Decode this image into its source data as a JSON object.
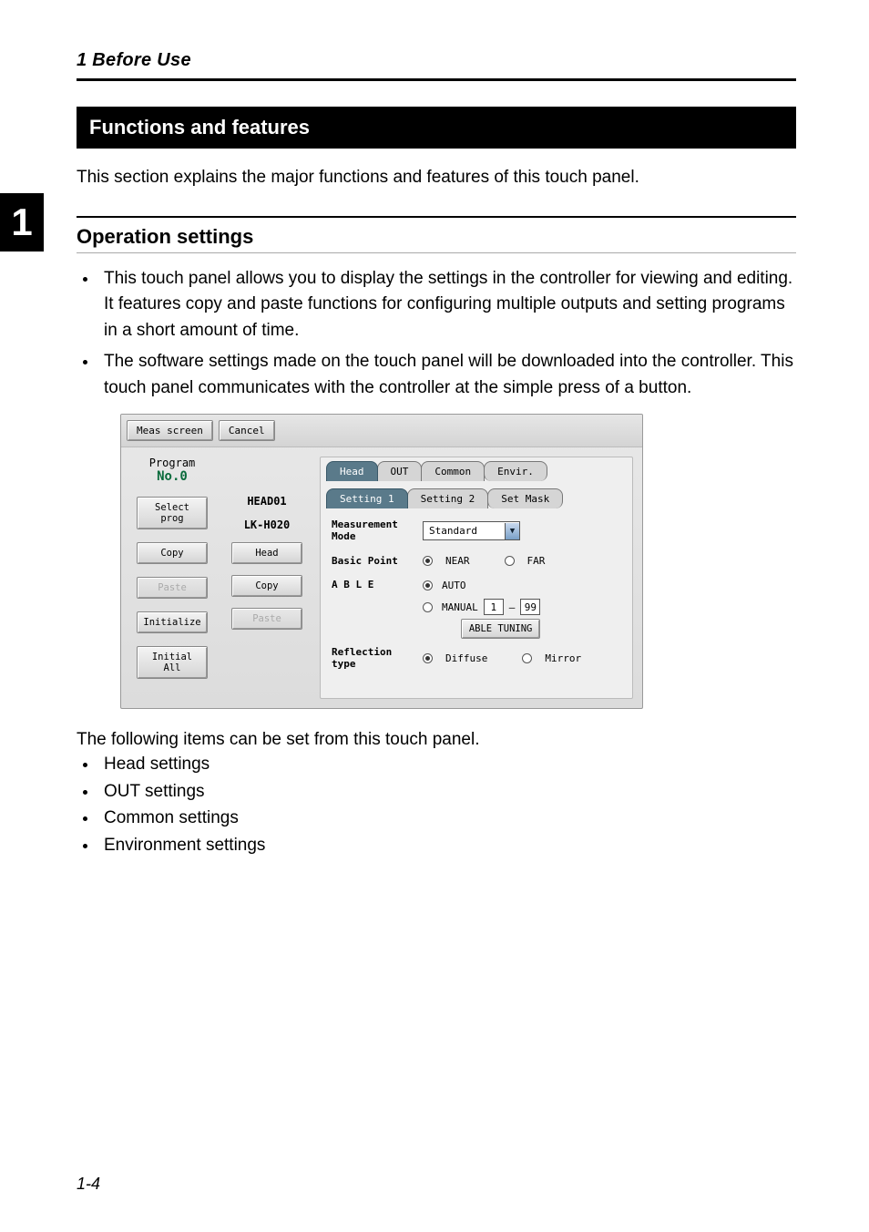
{
  "chapter": {
    "header": "1  Before Use",
    "tab_number": "1"
  },
  "section_title": "Functions and features",
  "intro": "This section explains the major functions and features of this touch panel.",
  "subsection_title": "Operation settings",
  "bullets_main": [
    "This touch panel allows you to display the settings in the controller for viewing and editing. It features copy and paste functions for configuring multiple outputs and setting programs in a short amount of time.",
    "The software settings made on the touch panel will be downloaded into the controller. This touch panel communicates with the controller at the simple press of a button."
  ],
  "screenshot": {
    "top_tabs": {
      "meas": "Meas screen",
      "cancel": "Cancel"
    },
    "left": {
      "program_label": "Program",
      "program_no": "No.0",
      "btn_select": "Select prog",
      "btn_copy": "Copy",
      "btn_paste": "Paste",
      "btn_init": "Initialize",
      "btn_init_all": "Initial All"
    },
    "mid": {
      "head_label": "HEAD01",
      "model": "LK-H020",
      "btn_head": "Head",
      "btn_copy": "Copy",
      "btn_paste": "Paste"
    },
    "tabs_upper": [
      "Head",
      "OUT",
      "Common",
      "Envir."
    ],
    "tabs_lower": [
      "Setting 1",
      "Setting 2",
      "Set Mask"
    ],
    "fields": {
      "meas_mode_lbl": "Measurement Mode",
      "meas_mode_val": "Standard",
      "basic_point_lbl": "Basic Point",
      "basic_point_opts": [
        "NEAR",
        "FAR"
      ],
      "able_lbl": "A B L E",
      "able_auto": "AUTO",
      "able_manual": "MANUAL",
      "able_from": "1",
      "able_dash": "–",
      "able_to": "99",
      "able_btn": "ABLE TUNING",
      "refl_lbl": "Reflection type",
      "refl_opts": [
        "Diffuse",
        "Mirror"
      ]
    }
  },
  "post_shot_text": "The following items can be set from this touch panel.",
  "items_list": [
    "Head settings",
    "OUT settings",
    "Common settings",
    "Environment settings"
  ],
  "page_number": "1-4"
}
